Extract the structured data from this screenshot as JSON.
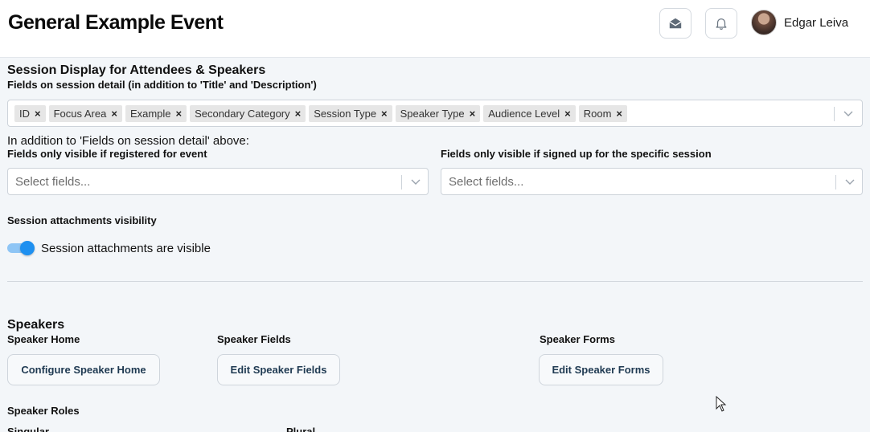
{
  "header": {
    "event_title": "General Example Event",
    "user_name": "Edgar Leiva"
  },
  "session_display": {
    "title": "Session Display for Attendees & Speakers",
    "fields_label": "Fields on session detail (in addition to 'Title' and 'Description')",
    "selected_fields": [
      "ID",
      "Focus Area",
      "Example",
      "Secondary Category",
      "Session Type",
      "Speaker Type",
      "Audience Level",
      "Room"
    ],
    "remove_glyph": "×",
    "addition_note": "In addition to 'Fields on session detail' above:",
    "registered_label": "Fields only visible if registered for event",
    "registered_placeholder": "Select fields...",
    "signed_up_label": "Fields only visible if signed up for the specific session",
    "signed_up_placeholder": "Select fields...",
    "attachments_label": "Session attachments visibility",
    "attachments_toggle_text": "Session attachments are visible",
    "attachments_visible": true
  },
  "speakers": {
    "title": "Speakers",
    "home_label": "Speaker Home",
    "home_button": "Configure Speaker Home",
    "fields_label": "Speaker Fields",
    "fields_button": "Edit Speaker Fields",
    "forms_label": "Speaker Forms",
    "forms_button": "Edit Speaker Forms",
    "roles_label": "Speaker Roles",
    "singular_label": "Singular",
    "plural_label": "Plural"
  },
  "colors": {
    "accent": "#1e90f0",
    "page_bg": "#f3f6f9"
  }
}
